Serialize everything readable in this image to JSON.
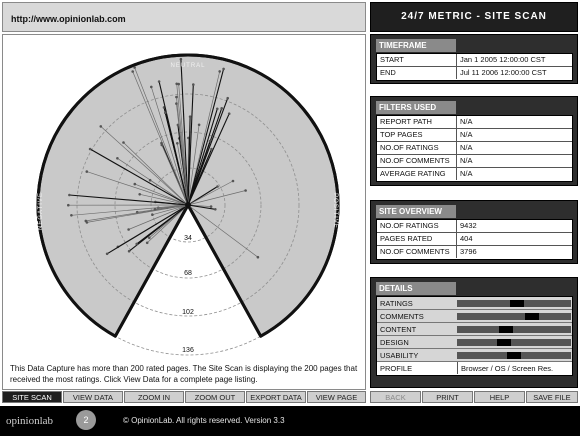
{
  "url": "http://www.opinionlab.com",
  "panel_title": "24/7 METRIC - SITE SCAN",
  "scan": {
    "top_label": "NEUTRAL",
    "left_label": "NEGATIVE",
    "right_label": "POSITIVE",
    "ring_labels": [
      "34",
      "68",
      "102",
      "136"
    ],
    "note": "This Data Capture has more than 200 rated pages.  The Site Scan is displaying the 200 pages that received the most ratings.  Click View Data for a complete page listing."
  },
  "timeframe": {
    "header": "TIMEFRAME",
    "rows": [
      {
        "label": "START",
        "value": "Jan 1 2005 12:00:00 CST"
      },
      {
        "label": "END",
        "value": "Jul 11 2006 12:00:00 CST"
      }
    ]
  },
  "filters": {
    "header": "FILTERS USED",
    "rows": [
      {
        "label": "REPORT PATH",
        "value": "N/A"
      },
      {
        "label": "TOP PAGES",
        "value": "N/A"
      },
      {
        "label": "NO.OF RATINGS",
        "value": "N/A"
      },
      {
        "label": "NO.OF COMMENTS",
        "value": "N/A"
      },
      {
        "label": "AVERAGE  RATING",
        "value": "N/A"
      }
    ]
  },
  "overview": {
    "header": "SITE OVERVIEW",
    "rows": [
      {
        "label": "NO.OF RATINGS",
        "value": "9432"
      },
      {
        "label": "PAGES RATED",
        "value": "404"
      },
      {
        "label": "NO.OF COMMENTS",
        "value": "3796"
      }
    ]
  },
  "details": {
    "header": "DETAILS",
    "rows": [
      {
        "label": "RATINGS",
        "level": 0.53
      },
      {
        "label": "COMMENTS",
        "level": 0.66
      },
      {
        "label": "CONTENT",
        "level": 0.43
      },
      {
        "label": "DESIGN",
        "level": 0.41
      },
      {
        "label": "USABILITY",
        "level": 0.5
      }
    ],
    "profile_label": "PROFILE",
    "profile_value": "Browser / OS / Screen Res."
  },
  "left_buttons": [
    "SITE SCAN",
    "VIEW DATA",
    "ZOOM IN",
    "ZOOM OUT",
    "EXPORT DATA",
    "VIEW PAGE"
  ],
  "right_buttons": [
    "BACK",
    "PRINT",
    "HELP",
    "SAVE FILE"
  ],
  "footer": {
    "logo": "opinionlab",
    "badge": "2",
    "copyright": "© OpinionLab. All rights reserved.  Version 3.3"
  }
}
